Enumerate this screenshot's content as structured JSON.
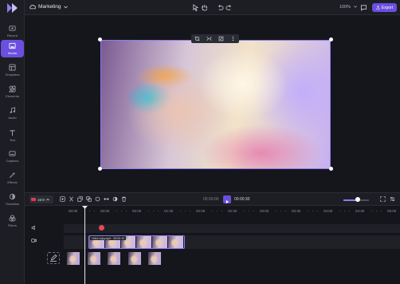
{
  "header": {
    "project_name": "Marketing",
    "zoom": "100%",
    "export_label": "Export"
  },
  "sidebar": {
    "items": [
      {
        "label": "Record",
        "icon": "record-icon"
      },
      {
        "label": "Media",
        "icon": "media-icon",
        "active": true
      },
      {
        "label": "Templates",
        "icon": "templates-icon"
      },
      {
        "label": "Elements",
        "icon": "elements-icon"
      },
      {
        "label": "Audio",
        "icon": "audio-icon"
      },
      {
        "label": "Text",
        "icon": "text-icon"
      },
      {
        "label": "Captions",
        "icon": "captions-icon"
      },
      {
        "label": "Effects",
        "icon": "effects-icon"
      },
      {
        "label": "Transition",
        "icon": "transition-icon"
      },
      {
        "label": "Filters",
        "icon": "filters-icon"
      }
    ]
  },
  "toolbar": {
    "aspect_ratio": "16:9",
    "current_time": "00:00:00",
    "total_time": "00:00:30",
    "zoom_level": 0.55
  },
  "timeline": {
    "ruler": [
      "00:00",
      "00:00",
      "00:00",
      "01:30",
      "02:00",
      "02:30",
      "03:00",
      "03:30",
      "04:00",
      "04:30",
      "05:00"
    ],
    "clip_label": "Video copyright · 00:00:30"
  },
  "colors": {
    "accent": "#6b4fe0",
    "marker": "#e24a57"
  }
}
